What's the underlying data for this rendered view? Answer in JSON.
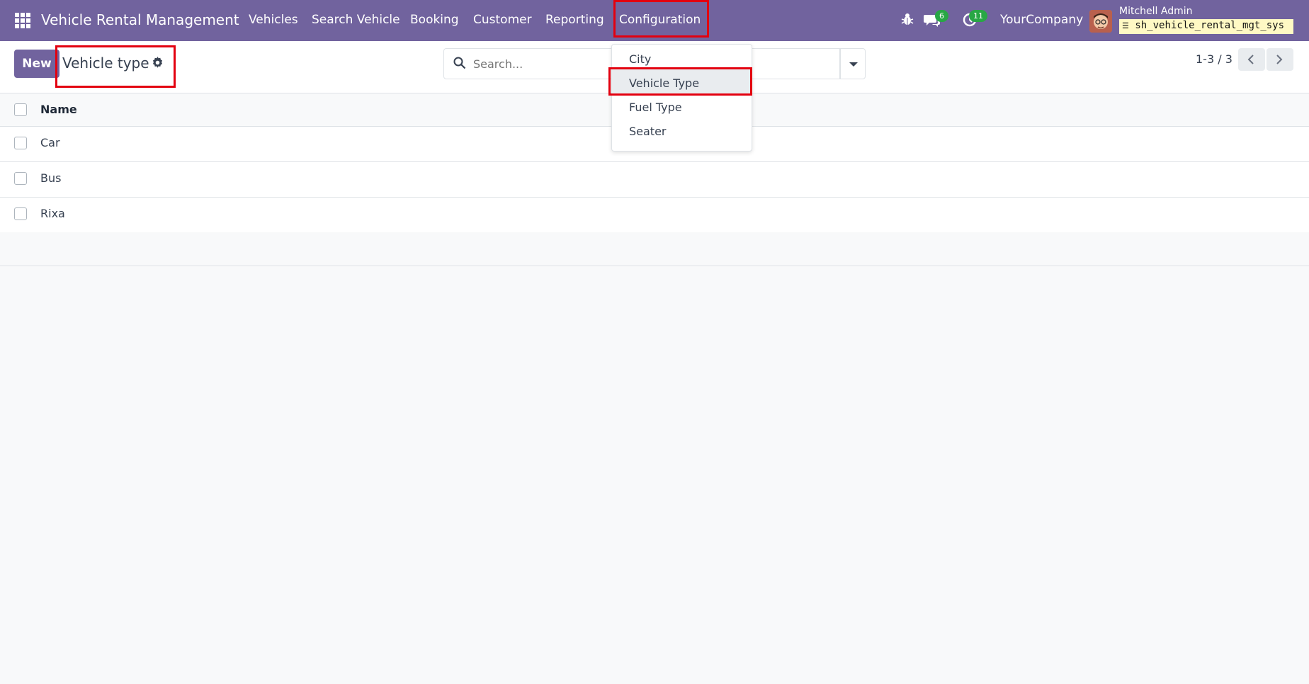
{
  "navbar": {
    "app_title": "Vehicle Rental Management",
    "menu": [
      "Vehicles",
      "Search Vehicle",
      "Booking",
      "Customer",
      "Reporting",
      "Configuration"
    ],
    "messages_count": "6",
    "activities_count": "11",
    "company": "YourCompany",
    "user_name": "Mitchell Admin",
    "database": "sh_vehicle_rental_mgt_sys"
  },
  "control_panel": {
    "new_label": "New",
    "title": "Vehicle type",
    "search_placeholder": "Search...",
    "pager": "1-3 / 3"
  },
  "list": {
    "column_name": "Name",
    "rows": [
      "Car",
      "Bus",
      "Rixa"
    ]
  },
  "dropdown": {
    "items": [
      "City",
      "Vehicle Type",
      "Fuel Type",
      "Seater"
    ],
    "active": "Vehicle Type"
  },
  "colors": {
    "navbar": "#71639e",
    "highlight": "#e3000f",
    "badge": "#28a745"
  }
}
